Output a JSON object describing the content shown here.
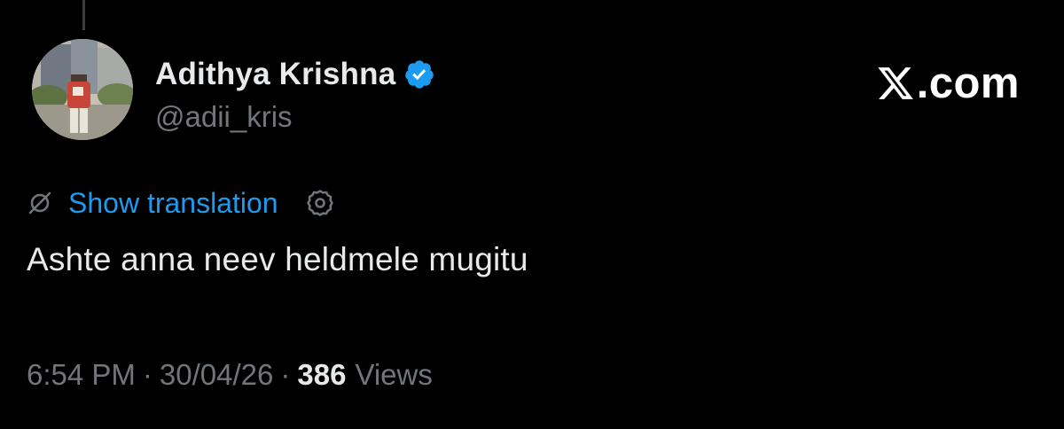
{
  "author": {
    "display_name": "Adithya Krishna",
    "handle": "@adii_kris",
    "verified": true,
    "avatar_icon": "profile-photo-avatar"
  },
  "brand": {
    "logo_icon": "x-logo-icon",
    "text": ".com"
  },
  "translation": {
    "icon": "no-translate-icon",
    "label": "Show translation",
    "settings_icon": "settings-gear-icon"
  },
  "tweet": {
    "text": "Ashte anna neev heldmele mugitu"
  },
  "meta": {
    "time": "6:54 PM",
    "date": "30/04/26",
    "separator": "·",
    "views_count": "386",
    "views_label": "Views"
  },
  "colors": {
    "background": "#000000",
    "text_primary": "#e7e9ea",
    "text_secondary": "#71767b",
    "accent": "#1d9bf0"
  }
}
